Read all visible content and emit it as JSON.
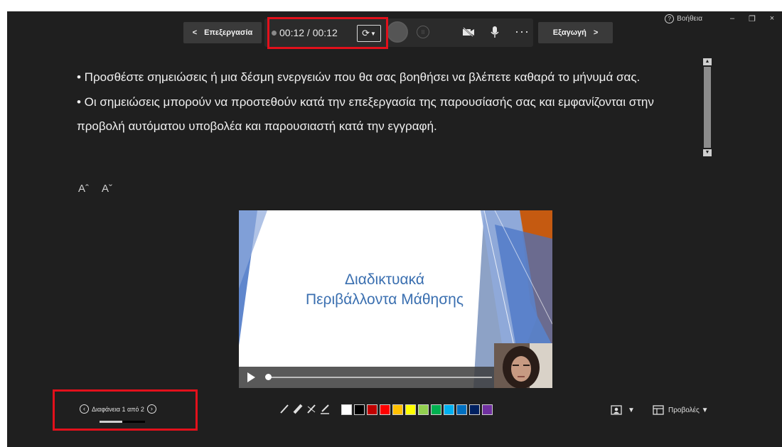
{
  "window": {
    "help_label": "Βοήθεια",
    "minimize_glyph": "–",
    "restore_glyph": "❐",
    "close_glyph": "×"
  },
  "toolbar": {
    "back_label": "Επεξεργασία",
    "back_icon": "chevron-left-icon",
    "export_label": "Εξαγωγή",
    "export_icon": "chevron-right-icon",
    "timer": "00:12 / 00:12",
    "retake_icon": "refresh-icon",
    "camera_icon": "camera-off-icon",
    "mic_icon": "microphone-icon",
    "more_label": "···"
  },
  "notes": {
    "lines": [
      "• Προσθέστε σημειώσεις ή μια δέσμη ενεργειών που θα σας βοηθήσει να βλέπετε καθαρά το μήνυμά σας.",
      "• Οι σημειώσεις μπορούν να προστεθούν κατά την επεξεργασία της παρουσίασής σας και εμφανίζονται στην προβολή αυτόματου υποβολέα και παρουσιαστή κατά την εγγραφή."
    ],
    "increase_font": "Aˆ",
    "decrease_font": "Aˇ"
  },
  "slide": {
    "title_line1": "Διαδικτυακά",
    "title_line2": "Περιβάλλοντα Μάθησης",
    "accent_colors": [
      "#4472c4",
      "#8faadc",
      "#c55a11",
      "#2f5597"
    ]
  },
  "slide_nav": {
    "label": "Διαφάνεια 1 από 2",
    "current": 1,
    "total": 2,
    "progress_fraction": 0.5
  },
  "ink": {
    "tools": [
      "pen-icon",
      "highlighter-icon",
      "eraser-icon",
      "marker-icon"
    ],
    "colors": [
      "#ffffff",
      "#000000",
      "#c00000",
      "#ff0000",
      "#ffc000",
      "#ffff00",
      "#92d050",
      "#00b050",
      "#00b0f0",
      "#0070c0",
      "#002060",
      "#7030a0"
    ]
  },
  "views": {
    "camera_label": "▼",
    "label": "Προβολές ▼"
  }
}
